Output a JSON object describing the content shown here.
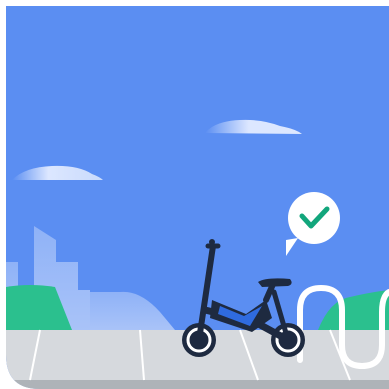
{
  "colors": {
    "sky": "#5B8EF2",
    "cloud": "#DCE7FF",
    "cloud_fade": "#5B8EF2",
    "building_light": "#8FB2F7",
    "building_lighter": "#A9C3F8",
    "hill_green": "#2BC08E",
    "ground": "#D6D9DD",
    "ground_shadow": "#AEB3B8",
    "road_line": "#FFFFFF",
    "bike_dark": "#1E2A40",
    "bike_blue": "#2F6BE0",
    "wheel_rim": "#FFFFFF",
    "check_bubble": "#FFFFFF",
    "check_mark": "#12A67C",
    "rack": "#FFFFFF"
  },
  "icons": {
    "bubble": "check-bubble-icon",
    "check": "checkmark-icon",
    "bike": "e-bike-icon"
  }
}
